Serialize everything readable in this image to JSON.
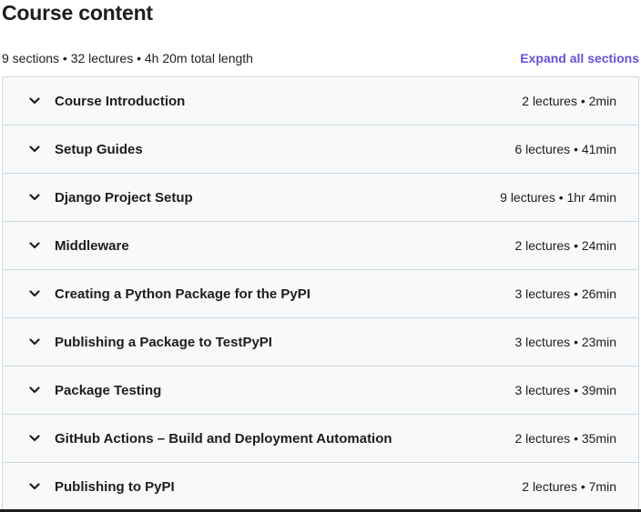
{
  "title": "Course content",
  "summary": "9 sections • 32 lectures • 4h 20m total length",
  "expand_label": "Expand all sections",
  "sections": [
    {
      "title": "Course Introduction",
      "meta": "2 lectures • 2min"
    },
    {
      "title": "Setup Guides",
      "meta": "6 lectures • 41min"
    },
    {
      "title": "Django Project Setup",
      "meta": "9 lectures • 1hr 4min"
    },
    {
      "title": "Middleware",
      "meta": "2 lectures • 24min"
    },
    {
      "title": "Creating a Python Package for the PyPI",
      "meta": "3 lectures • 26min"
    },
    {
      "title": "Publishing a Package to TestPyPI",
      "meta": "3 lectures • 23min"
    },
    {
      "title": "Package Testing",
      "meta": "3 lectures • 39min"
    },
    {
      "title": "GitHub Actions – Build and Deployment Automation",
      "meta": "2 lectures • 35min"
    },
    {
      "title": "Publishing to PyPI",
      "meta": "2 lectures • 7min"
    }
  ],
  "colors": {
    "accent": "#6a4fd6",
    "text": "#1c1d1f",
    "section_bg": "#f7f9fa",
    "border": "#d1d7dc"
  },
  "icons": {
    "section_toggle": "chevron-down-icon"
  }
}
